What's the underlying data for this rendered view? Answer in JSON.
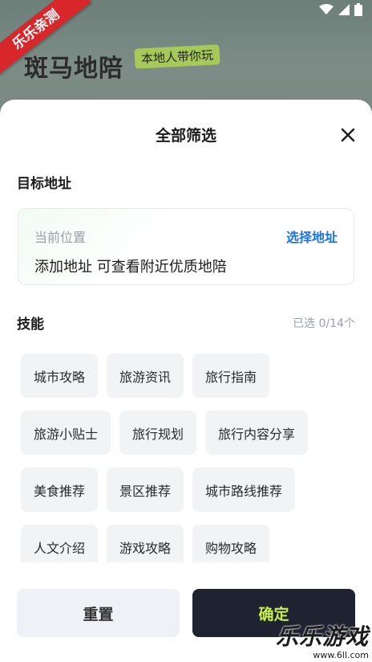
{
  "background": {
    "ribbon_text": "乐乐亲测",
    "logo_text": "斑马地陪",
    "logo_slogan": "本地人带你玩"
  },
  "sheet": {
    "title": "全部筛选",
    "address_section": {
      "label": "目标地址",
      "current_label": "当前位置",
      "pick_label": "选择地址",
      "add_text": "添加地址 可查看附近优质地陪"
    },
    "skills_section": {
      "label": "技能",
      "count": "已选 0/14个",
      "rows": [
        [
          "城市攻略",
          "旅游资讯",
          "旅行指南"
        ],
        [
          "旅游小贴士",
          "旅行规划",
          "旅行内容分享"
        ],
        [
          "美食推荐",
          "景区推荐",
          "城市路线推荐"
        ],
        [
          "人文介绍",
          "游戏攻略",
          "购物攻略"
        ]
      ]
    }
  },
  "footer": {
    "reset_label": "重置",
    "confirm_label": "确定"
  },
  "watermark": {
    "main": "乐乐游戏",
    "url": "www.6ll.com"
  },
  "colors": {
    "accent_link": "#1a73e8",
    "confirm_bg": "#1f2230",
    "confirm_text": "#c7f04a",
    "chip_bg": "#f2f3f5"
  }
}
